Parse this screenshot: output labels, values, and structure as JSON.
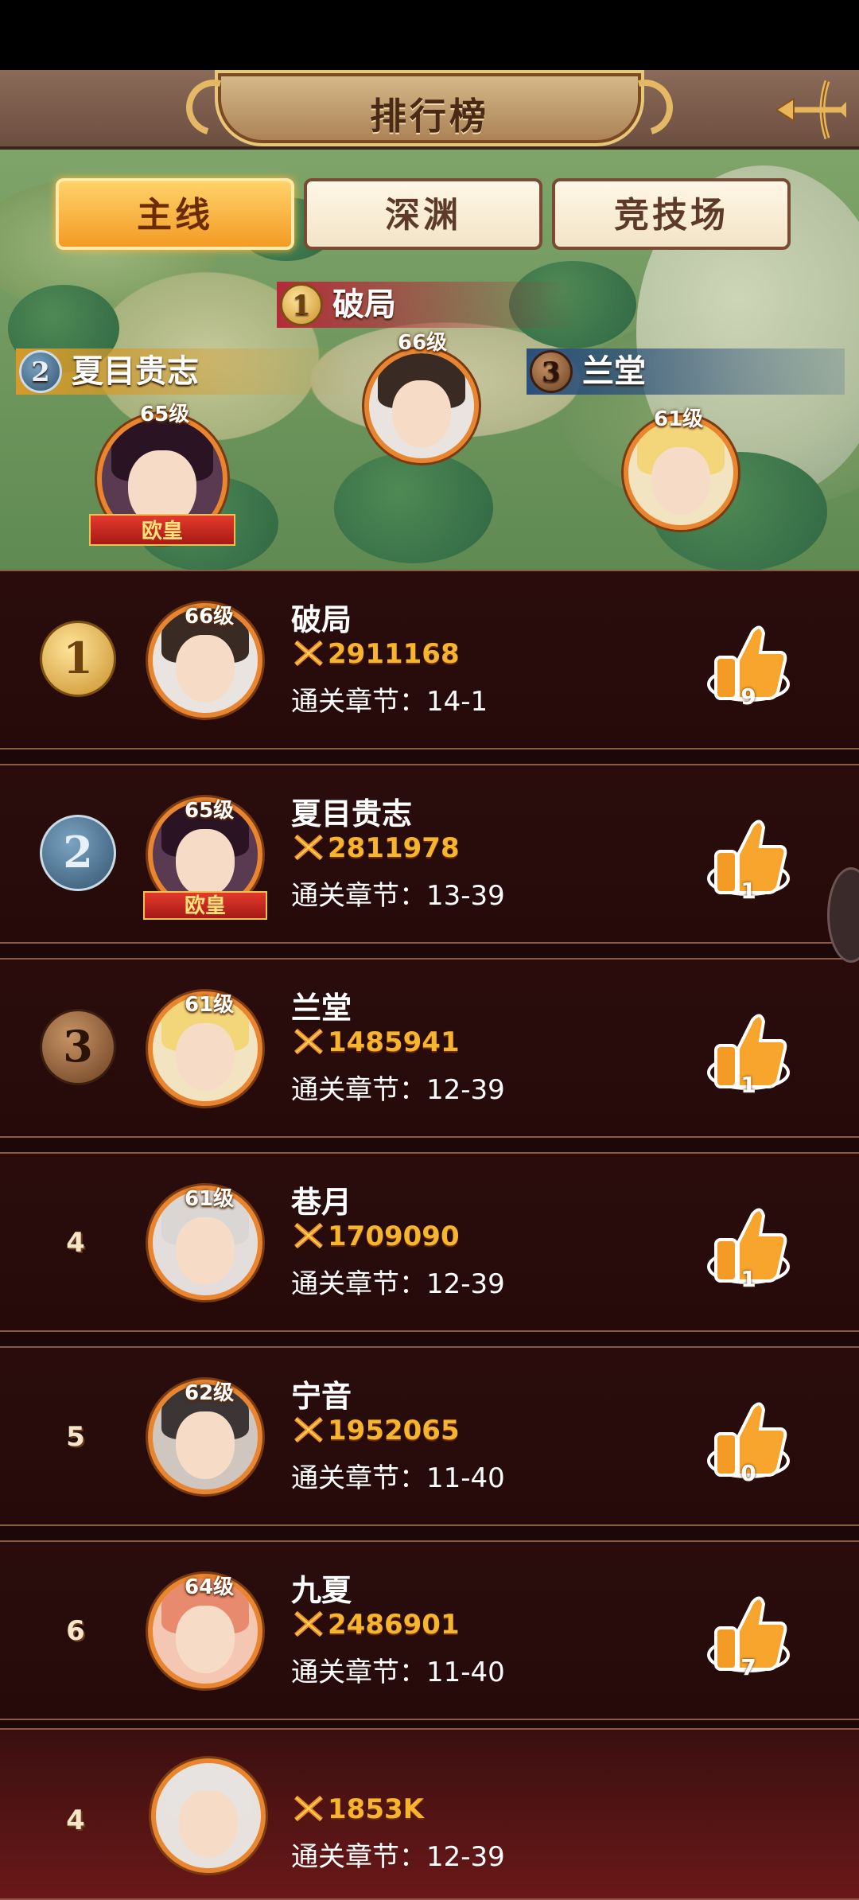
{
  "header": {
    "title": "排行榜"
  },
  "tabs": [
    {
      "label": "主线",
      "active": true
    },
    {
      "label": "深渊",
      "active": false
    },
    {
      "label": "竞技场",
      "active": false
    }
  ],
  "podium": [
    {
      "rank": "1",
      "name": "破局",
      "level": "66级"
    },
    {
      "rank": "2",
      "name": "夏目贵志",
      "level": "65级",
      "title_badge": "欧皇"
    },
    {
      "rank": "3",
      "name": "兰堂",
      "level": "61级"
    }
  ],
  "rows": [
    {
      "rank": "1",
      "name": "破局",
      "level": "66级",
      "power": "2911168",
      "chapter": "通关章节：14-1",
      "likes": "9"
    },
    {
      "rank": "2",
      "name": "夏目贵志",
      "level": "65级",
      "title_badge": "欧皇",
      "power": "2811978",
      "chapter": "通关章节：13-39",
      "likes": "1"
    },
    {
      "rank": "3",
      "name": "兰堂",
      "level": "61级",
      "power": "1485941",
      "chapter": "通关章节：12-39",
      "likes": "1"
    },
    {
      "rank": "4",
      "name": "巷月",
      "level": "61级",
      "power": "1709090",
      "chapter": "通关章节：12-39",
      "likes": "1"
    },
    {
      "rank": "5",
      "name": "宁音",
      "level": "62级",
      "power": "1952065",
      "chapter": "通关章节：11-40",
      "likes": "0"
    },
    {
      "rank": "6",
      "name": "九夏",
      "level": "64级",
      "power": "2486901",
      "chapter": "通关章节：11-40",
      "likes": "7"
    }
  ],
  "self_row": {
    "rank": "4",
    "power": "1853K",
    "chapter": "通关章节：12-39"
  },
  "colors": {
    "accent": "#f39b24",
    "row_bg": "#2a0c0c",
    "power_text": "#f6b52c"
  }
}
